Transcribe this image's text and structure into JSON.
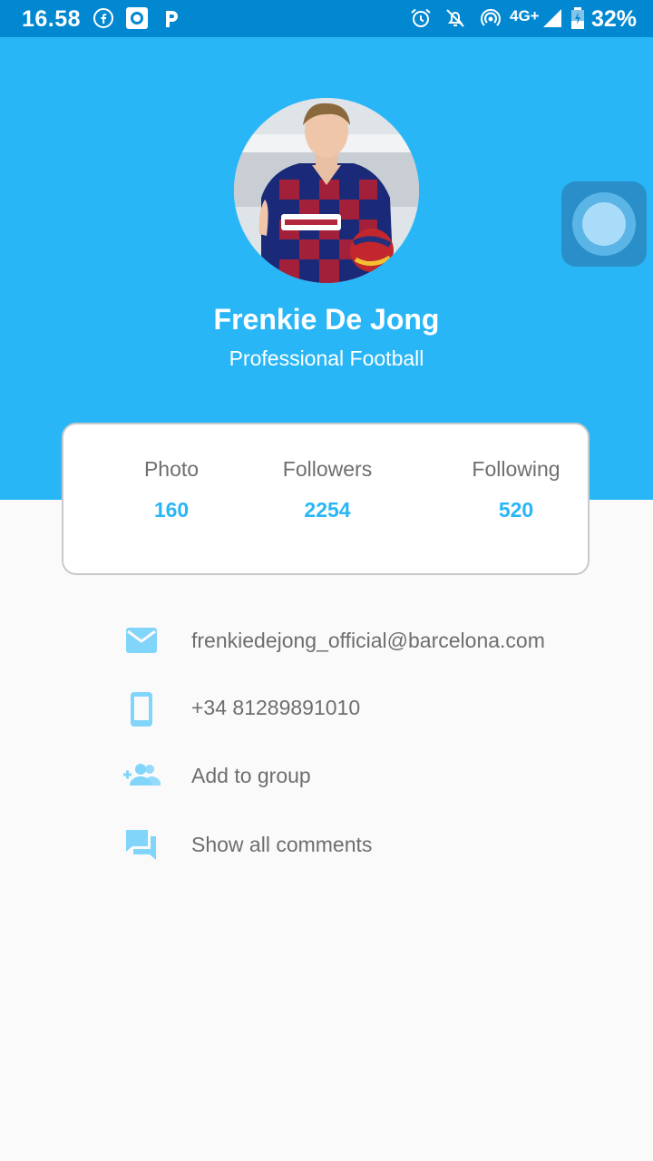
{
  "status_bar": {
    "time": "16.58",
    "network": "4G+",
    "battery": "32%",
    "app_icons": [
      "facebook-icon",
      "camera-record-icon",
      "p-app-icon"
    ],
    "system_icons": [
      "alarm-icon",
      "notifications-off-icon",
      "hotspot-icon",
      "signal-icon",
      "battery-charging-icon"
    ]
  },
  "profile": {
    "name": "Frenkie De Jong",
    "title": "Professional Football"
  },
  "stats": [
    {
      "label": "Photo",
      "value": "160"
    },
    {
      "label": "Followers",
      "value": "2254"
    },
    {
      "label": "Following",
      "value": "520"
    }
  ],
  "info": [
    {
      "icon": "email-icon",
      "text": "frenkiedejong_official@barcelona.com"
    },
    {
      "icon": "phone-icon",
      "text": "+34 81289891010"
    },
    {
      "icon": "group-add-icon",
      "text": "Add to group"
    },
    {
      "icon": "comments-icon",
      "text": "Show all comments"
    }
  ],
  "colors": {
    "status_bar": "#0288d1",
    "header": "#29b6f6",
    "accent": "#29b6f6",
    "icon": "#81d4fa",
    "text_gray": "#6e6e6e",
    "background": "#fafafa"
  }
}
